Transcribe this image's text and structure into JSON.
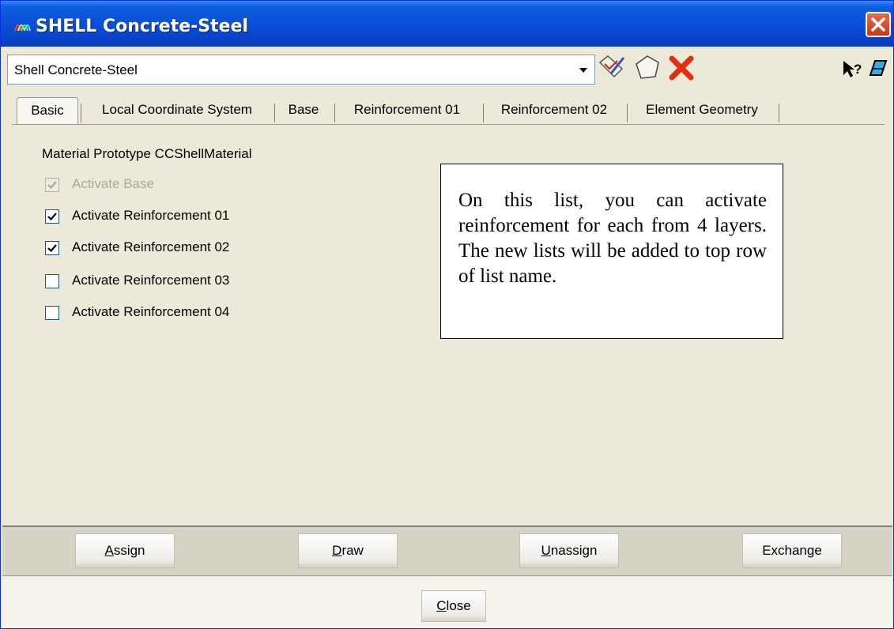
{
  "window": {
    "title": "SHELL Concrete-Steel",
    "icon": "app-rainbow-icon"
  },
  "toolbar": {
    "combo_value": "Shell Concrete-Steel",
    "icons": [
      "dropdown-arrow-icon",
      "rename-edit-icon",
      "new-shape-icon",
      "delete-x-icon",
      "help-pointer-icon",
      "eraser-icon"
    ]
  },
  "tabs": [
    {
      "label": "Basic",
      "active": true
    },
    {
      "label": "Local Coordinate System",
      "active": false
    },
    {
      "label": "Base",
      "active": false
    },
    {
      "label": "Reinforcement 01",
      "active": false
    },
    {
      "label": "Reinforcement 02",
      "active": false
    },
    {
      "label": "Element Geometry",
      "active": false
    }
  ],
  "basic": {
    "material_prototype": "Material Prototype  CCShellMaterial",
    "checkboxes": [
      {
        "label": "Activate Base",
        "checked": true,
        "enabled": false
      },
      {
        "label": "Activate Reinforcement 01",
        "checked": true,
        "enabled": true
      },
      {
        "label": "Activate Reinforcement 02",
        "checked": true,
        "enabled": true
      },
      {
        "label": "Activate Reinforcement 03",
        "checked": false,
        "enabled": true
      },
      {
        "label": "Activate Reinforcement 04",
        "checked": false,
        "enabled": true
      }
    ]
  },
  "note": {
    "text": "On this list, you can activate reinforcement for each from 4 layers. The new lists will be added to top row of list name."
  },
  "buttons": {
    "assign": {
      "first": "A",
      "rest": "ssign"
    },
    "draw": {
      "first": "D",
      "rest": "raw"
    },
    "unassign": {
      "first": "U",
      "rest": "nassign"
    },
    "exchange": "Exchange",
    "close": {
      "first": "C",
      "rest": "lose"
    }
  },
  "colors": {
    "titlebar": "#0a50d8",
    "dialog_bg": "#ece9d8",
    "close_button": "#c43a18"
  }
}
